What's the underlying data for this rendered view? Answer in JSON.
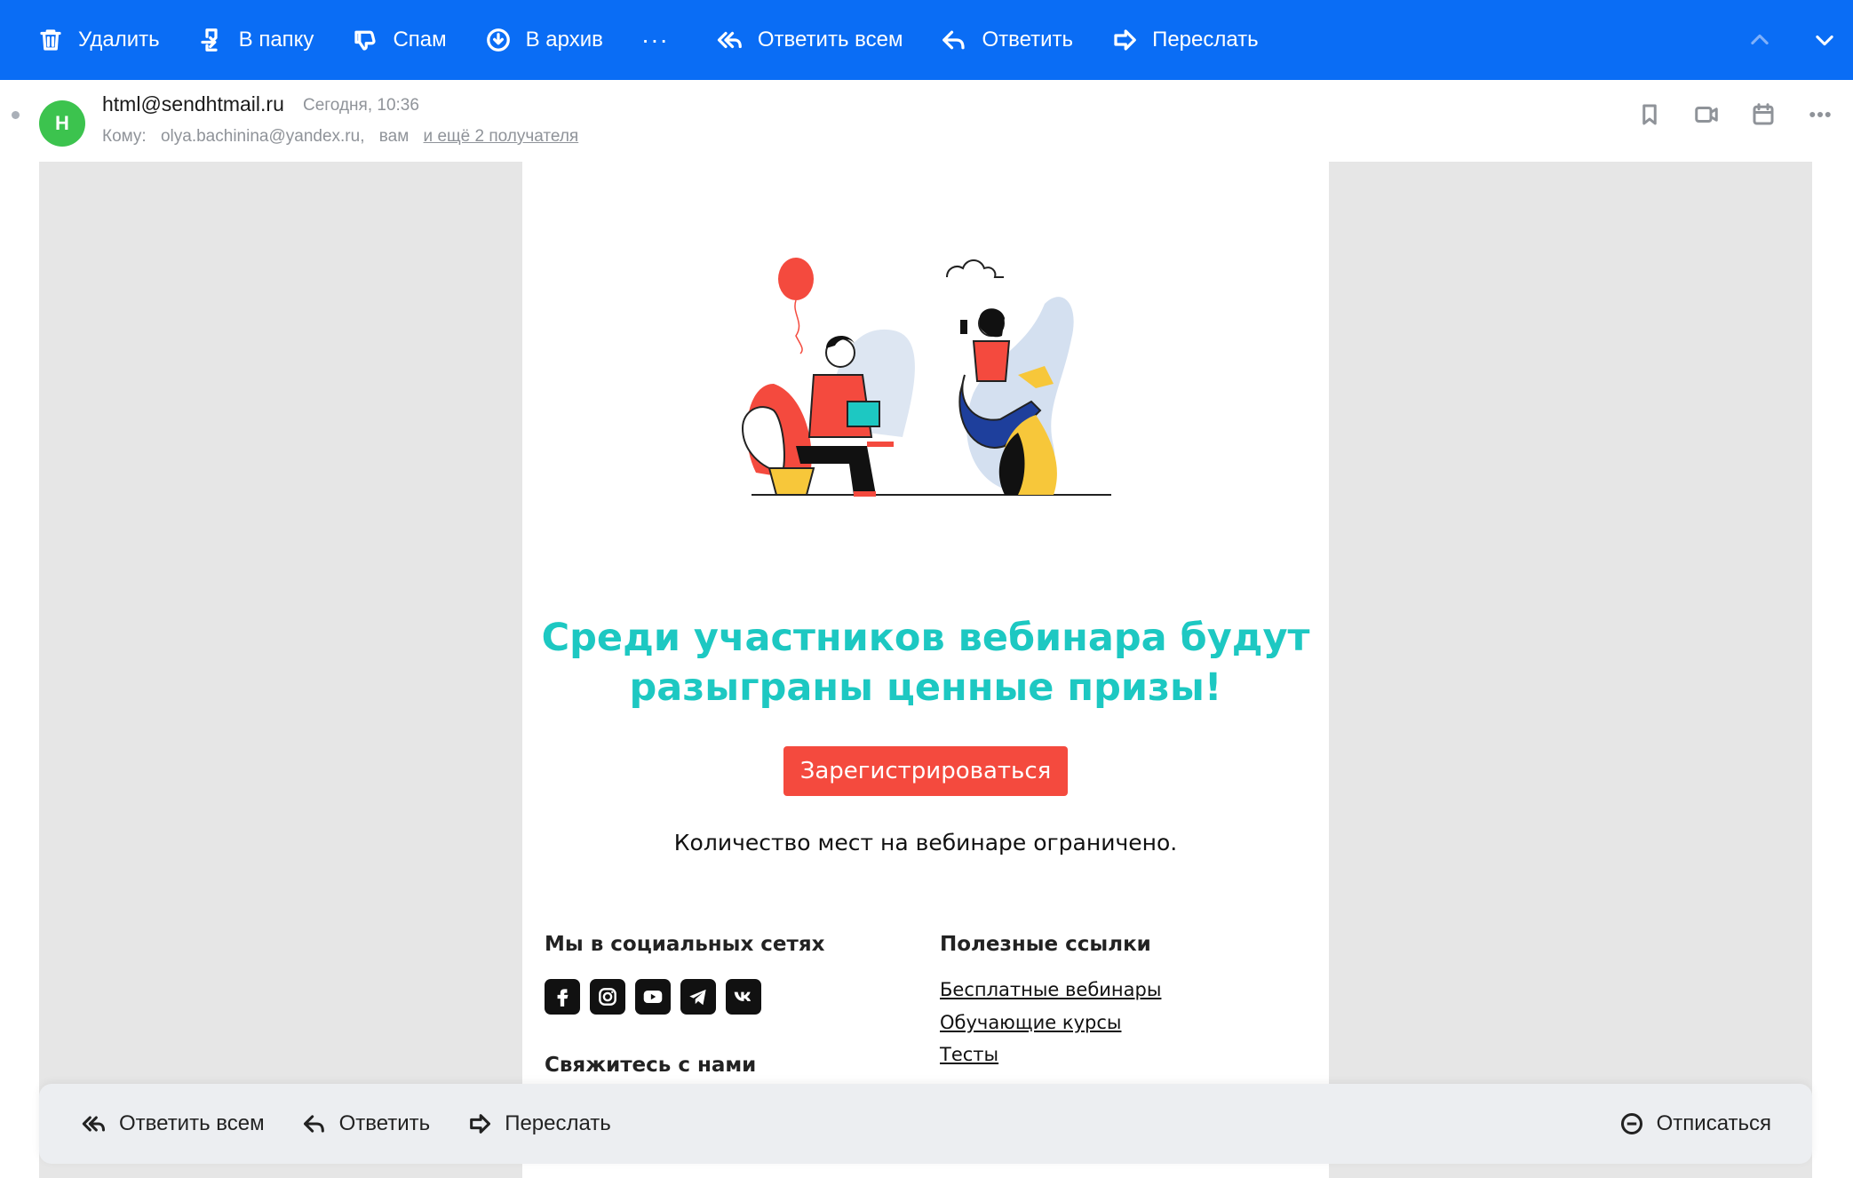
{
  "toolbar": {
    "delete_label": "Удалить",
    "move_label": "В папку",
    "spam_label": "Спам",
    "archive_label": "В архив",
    "more_label": "···",
    "reply_all_label": "Ответить всем",
    "reply_label": "Ответить",
    "forward_label": "Переслать"
  },
  "message": {
    "avatar_letter": "H",
    "avatar_color": "#3cc34e",
    "sender": "html@sendhtmail.ru",
    "date": "Сегодня, 10:36",
    "to_label": "Кому:",
    "to_address": "olya.bachinina@yandex.ru,",
    "to_you": "вам",
    "more_recipients": "и ещё 2 получателя"
  },
  "email": {
    "headline_line1": "Среди участников вебинара будут",
    "headline_line2": "разыграны ценные призы!",
    "cta_label": "Зарегистрироваться",
    "limit_text": "Количество мест на вебинаре ограничено.",
    "social_heading": "Мы в социальных сетях",
    "contact_heading": "Свяжитесь с нами",
    "links_heading": "Полезные ссылки",
    "links": [
      "Бесплатные вебинары",
      "Обучающие курсы",
      "Тесты"
    ],
    "socials": [
      "facebook-icon",
      "instagram-icon",
      "youtube-icon",
      "telegram-icon",
      "vk-icon"
    ]
  },
  "bottom_bar": {
    "reply_all_label": "Ответить всем",
    "reply_label": "Ответить",
    "forward_label": "Переслать",
    "unsubscribe_label": "Отписаться"
  },
  "colors": {
    "toolbar_blue": "#0a6df5",
    "headline_teal": "#1dc8c2",
    "cta_red": "#f44a3e"
  }
}
